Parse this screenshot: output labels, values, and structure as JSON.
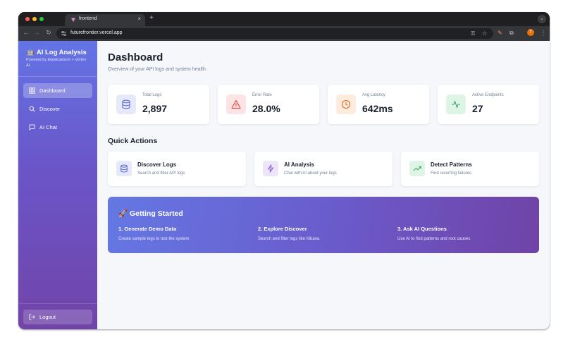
{
  "browser": {
    "tab_title": "frontend",
    "tab_close": "×",
    "new_tab": "+",
    "url": "futurefrontier.vercel.app",
    "profile_initial": "T"
  },
  "sidebar": {
    "brand_title": "AI Log Analysis",
    "brand_subtitle": "Powered by Elasticsearch + Vertex AI",
    "items": [
      {
        "label": "Dashboard",
        "icon": "dashboard-grid-icon",
        "active": true
      },
      {
        "label": "Discover",
        "icon": "search-icon",
        "active": false
      },
      {
        "label": "AI Chat",
        "icon": "chat-bubble-icon",
        "active": false
      }
    ],
    "logout_label": "Logout"
  },
  "header": {
    "title": "Dashboard",
    "subtitle": "Overview of your API logs and system health"
  },
  "stats": [
    {
      "label": "Total Logs",
      "value": "2,897",
      "icon": "database-icon",
      "color": "#5a67d8",
      "bg": "#e6e9fa"
    },
    {
      "label": "Error Rate",
      "value": "28.0%",
      "icon": "warning-triangle-icon",
      "color": "#e53e3e",
      "bg": "#fde3e3"
    },
    {
      "label": "Avg Latency",
      "value": "642ms",
      "icon": "clock-icon",
      "color": "#dd6b20",
      "bg": "#fdebdd"
    },
    {
      "label": "Active Endpoints",
      "value": "27",
      "icon": "activity-pulse-icon",
      "color": "#38a169",
      "bg": "#def5e6"
    }
  ],
  "quick_actions": {
    "title": "Quick Actions",
    "items": [
      {
        "title": "Discover Logs",
        "desc": "Search and filter API logs",
        "icon": "database-icon",
        "color": "#5a67d8",
        "bg": "#e6e9fa"
      },
      {
        "title": "AI Analysis",
        "desc": "Chat with AI about your logs",
        "icon": "lightning-icon",
        "color": "#805ad5",
        "bg": "#ede5fa"
      },
      {
        "title": "Detect Patterns",
        "desc": "Find recurring failures",
        "icon": "trend-up-icon",
        "color": "#38a169",
        "bg": "#def5e6"
      }
    ]
  },
  "getting_started": {
    "title": "🚀 Getting Started",
    "steps": [
      {
        "title": "1. Generate Demo Data",
        "desc": "Create sample logs to test the system"
      },
      {
        "title": "2. Explore Discover",
        "desc": "Search and filter logs like Kibana"
      },
      {
        "title": "3. Ask AI Questions",
        "desc": "Use AI to find patterns and root causes"
      }
    ]
  }
}
